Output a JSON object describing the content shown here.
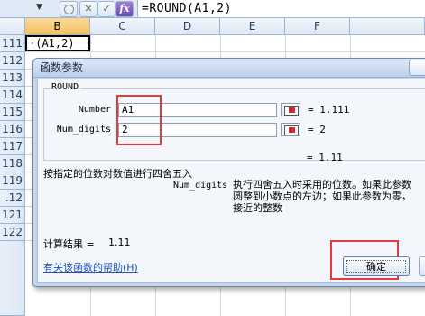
{
  "formula_bar": {
    "dropdown_glyph": "▼",
    "cancel_glyph": "✕",
    "enter_glyph": "✓",
    "fx_label": "fx",
    "formula": "=ROUND(A1,2)"
  },
  "columns": [
    "B",
    "C",
    "D",
    "E",
    "F"
  ],
  "rows": [
    "111",
    "112",
    "113",
    "114",
    "115",
    "116",
    "117",
    "118",
    "119",
    ".12",
    "121",
    "122"
  ],
  "active_cell_text": "·(A1,2)",
  "dialog": {
    "title": "函数参数",
    "function_name": "ROUND",
    "args": [
      {
        "label": "Number",
        "value": "A1",
        "result": "= 1.111"
      },
      {
        "label": "Num_digits",
        "value": "2",
        "result": "= 2"
      }
    ],
    "formula_result_inline": "= 1.11",
    "description": "按指定的位数对数值进行四舍五入",
    "param_name": "Num_digits",
    "param_desc": "执行四舍五入时采用的位数。如果此参数\n圆整到小数点的左边；如果此参数为零，\n接近的整数",
    "calc_result_label": "计算结果 =",
    "calc_result_value": "1.11",
    "help_link": "有关该函数的帮助(H)",
    "ok_label": "确定"
  },
  "colors": {
    "highlight_box": "#e33b3b",
    "link": "#1f53b5",
    "dialog_bg": "#f3f6fb"
  }
}
